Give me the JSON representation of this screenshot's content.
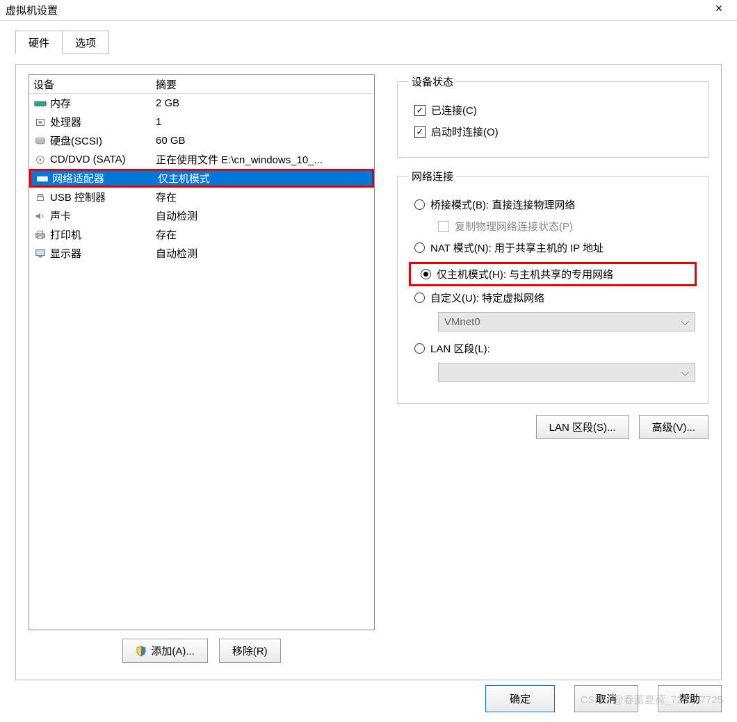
{
  "window": {
    "title": "虚拟机设置",
    "closeLabel": "×"
  },
  "tabs": {
    "hardware": "硬件",
    "options": "选项"
  },
  "list": {
    "colDevice": "设备",
    "colSummary": "摘要",
    "items": [
      {
        "icon": "memory",
        "name": "内存",
        "summary": "2 GB"
      },
      {
        "icon": "cpu",
        "name": "处理器",
        "summary": "1"
      },
      {
        "icon": "disk",
        "name": "硬盘(SCSI)",
        "summary": "60 GB"
      },
      {
        "icon": "cd",
        "name": "CD/DVD (SATA)",
        "summary": "正在使用文件 E:\\cn_windows_10_..."
      },
      {
        "icon": "net",
        "name": "网络适配器",
        "summary": "仅主机模式",
        "selected": true,
        "highlight": true
      },
      {
        "icon": "usb",
        "name": "USB 控制器",
        "summary": "存在"
      },
      {
        "icon": "sound",
        "name": "声卡",
        "summary": "自动检测"
      },
      {
        "icon": "printer",
        "name": "打印机",
        "summary": "存在"
      },
      {
        "icon": "display",
        "name": "显示器",
        "summary": "自动检测"
      }
    ]
  },
  "listButtons": {
    "add": "添加(A)...",
    "remove": "移除(R)"
  },
  "deviceStatus": {
    "legend": "设备状态",
    "connected": "已连接(C)",
    "connectedChecked": true,
    "connectOnStart": "启动时连接(O)",
    "connectOnStartChecked": true
  },
  "netConn": {
    "legend": "网络连接",
    "bridged": "桥接模式(B): 直接连接物理网络",
    "replicate": "复制物理网络连接状态(P)",
    "nat": "NAT 模式(N): 用于共享主机的 IP 地址",
    "hostOnly": "仅主机模式(H): 与主机共享的专用网络",
    "custom": "自定义(U): 特定虚拟网络",
    "customSelect": "VMnet0",
    "lanSegment": "LAN 区段(L):",
    "lanSelect": "",
    "selected": "hostOnly"
  },
  "rightButtons": {
    "lanSegments": "LAN 区段(S)...",
    "advanced": "高级(V)..."
  },
  "bottom": {
    "ok": "确定",
    "cancel": "取消",
    "help": "帮助"
  },
  "watermark": "CSDN @春蕾夏荷_728297725"
}
